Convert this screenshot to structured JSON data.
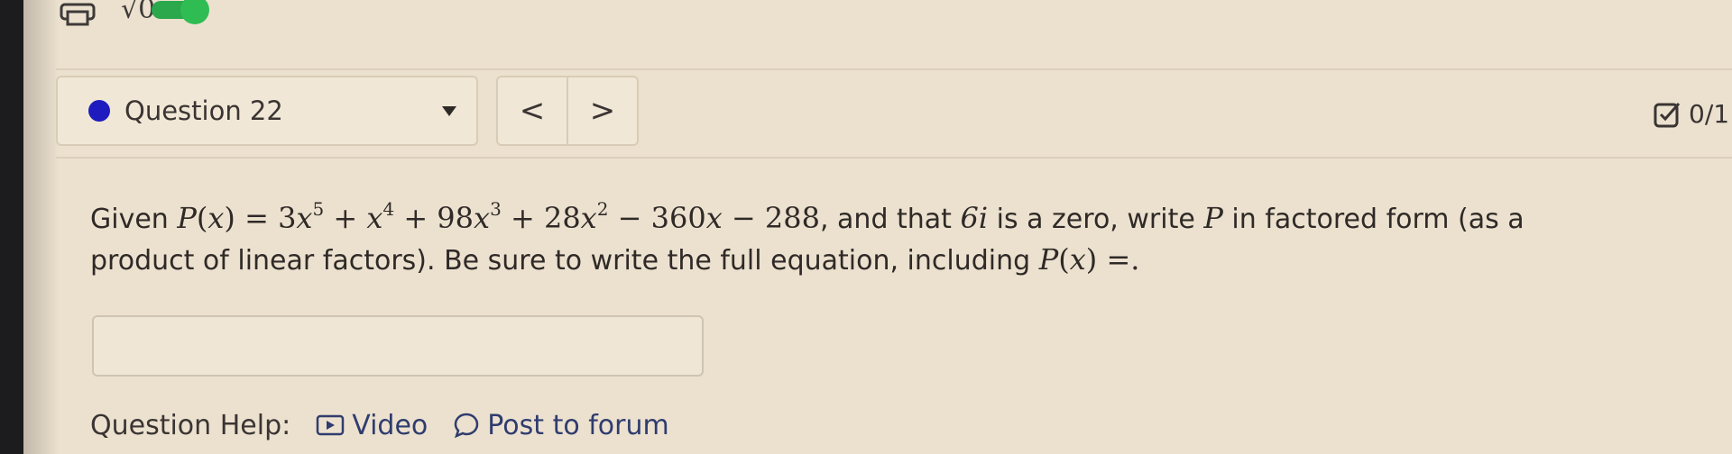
{
  "toolbar": {
    "print_icon": "printer-icon",
    "math_icon": "sqrt-icon",
    "math_icon_text": "√0",
    "toggle_on": true,
    "toggle_color": "#2fbd53"
  },
  "question_nav": {
    "label": "Question 22",
    "status_dot_color": "#1e1bbf",
    "prev_label": "<",
    "next_label": ">"
  },
  "score": {
    "text": "0/1"
  },
  "question": {
    "intro": "Given",
    "poly_name": "P",
    "var": "x",
    "terms": {
      "t1_coef": "3",
      "t1_exp": "5",
      "t2_exp": "4",
      "t3_coef": "98",
      "t3_exp": "3",
      "t4_coef": "28",
      "t4_exp": "2",
      "t5_coef": "360",
      "t6_const": "288"
    },
    "after_poly": ", and that",
    "zero_value": "6i",
    "after_zero": "is a zero, write",
    "after_p": "in factored form (as a product of linear factors). Be sure to write the full equation, including"
  },
  "answer": {
    "value": "",
    "placeholder": ""
  },
  "help": {
    "label": "Question Help:",
    "video_label": "Video",
    "forum_label": "Post to forum"
  }
}
